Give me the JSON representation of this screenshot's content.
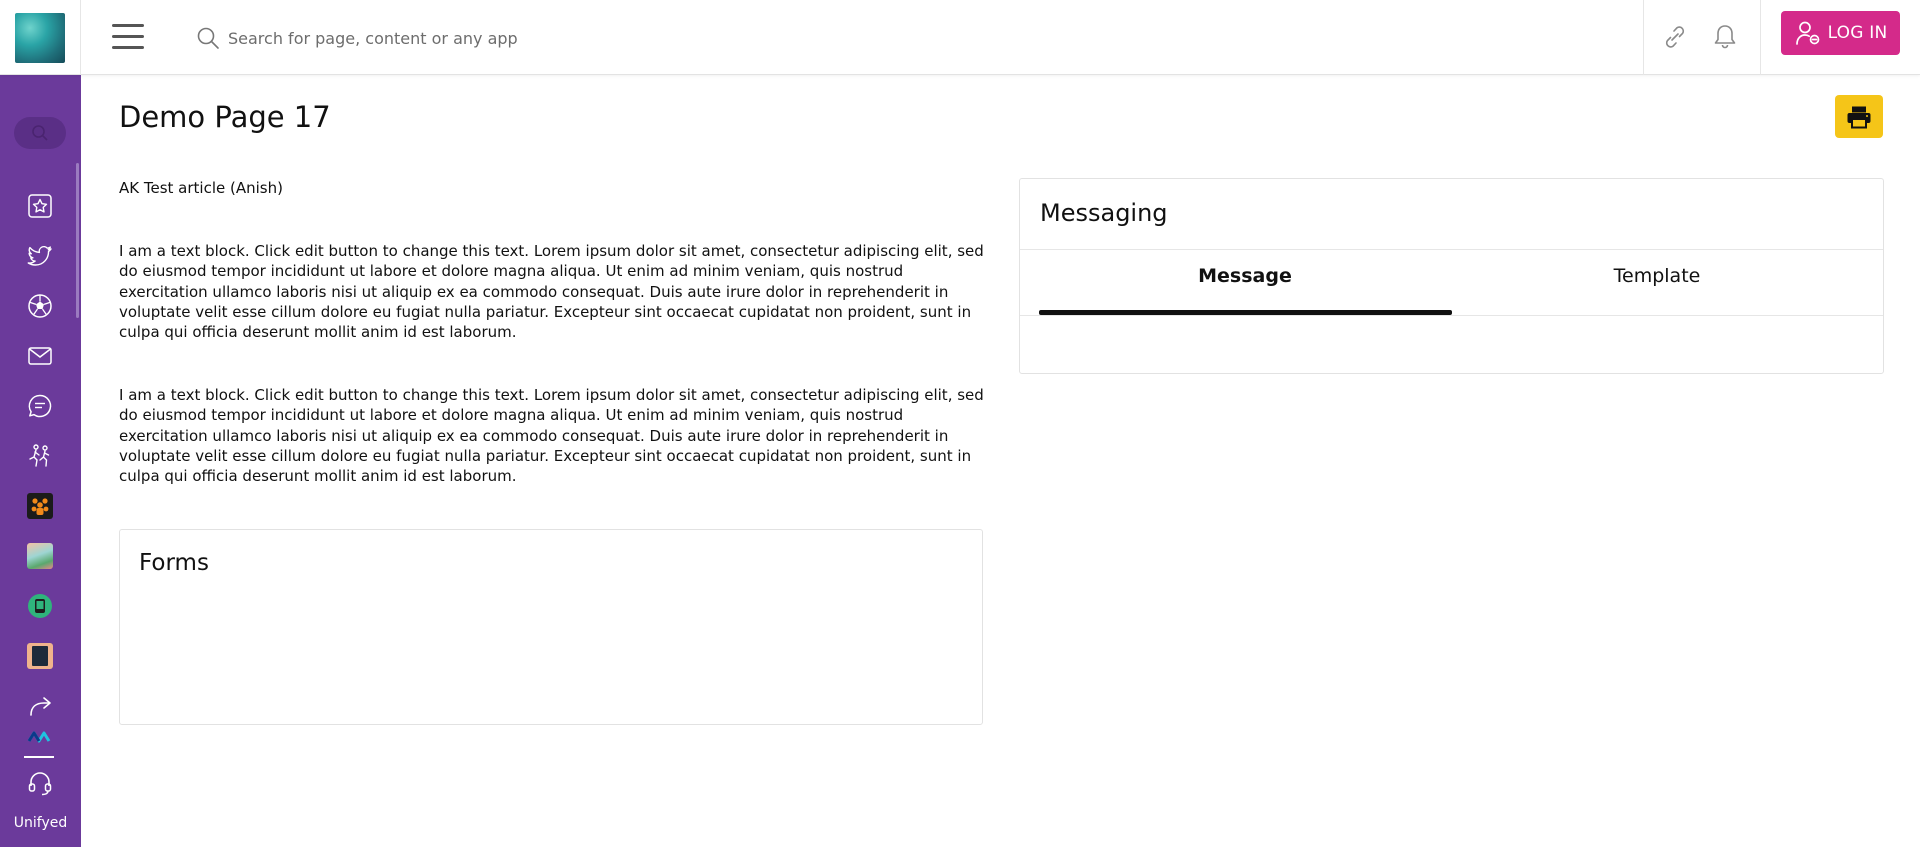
{
  "header": {
    "search_placeholder": "Search for page, content or any app",
    "login_label": "LOG IN"
  },
  "sidebar": {
    "items": [
      {
        "icon": "star-icon"
      },
      {
        "icon": "twitter-icon"
      },
      {
        "icon": "soccer-ball-icon"
      },
      {
        "icon": "mail-icon"
      },
      {
        "icon": "chat-icon"
      },
      {
        "icon": "running-people-icon"
      },
      {
        "icon": "orange-group-app-icon"
      },
      {
        "icon": "landscape-app-icon"
      },
      {
        "icon": "green-phone-app-icon"
      },
      {
        "icon": "dark-book-app-icon"
      },
      {
        "icon": "share-arrow-icon"
      },
      {
        "icon": "wave-logo-icon"
      }
    ],
    "support_icon": "headset-icon",
    "bottom_label": "Unifyed"
  },
  "page": {
    "title": "Demo Page 17",
    "article_title": "AK Test article (Anish)",
    "paragraphs": [
      "I am a text block. Click edit button to change this text. Lorem ipsum dolor sit amet, consectetur adipiscing elit, sed do eiusmod tempor incididunt ut labore et dolore magna aliqua. Ut enim ad minim veniam, quis nostrud exercitation ullamco laboris nisi ut aliquip ex ea commodo consequat. Duis aute irure dolor in reprehenderit in voluptate velit esse cillum dolore eu fugiat nulla pariatur. Excepteur sint occaecat cupidatat non proident, sunt in culpa qui officia deserunt mollit anim id est laborum.",
      "I am a text block. Click edit button to change this text. Lorem ipsum dolor sit amet, consectetur adipiscing elit, sed do eiusmod tempor incididunt ut labore et dolore magna aliqua. Ut enim ad minim veniam, quis nostrud exercitation ullamco laboris nisi ut aliquip ex ea commodo consequat. Duis aute irure dolor in reprehenderit in voluptate velit esse cillum dolore eu fugiat nulla pariatur. Excepteur sint occaecat cupidatat non proident, sunt in culpa qui officia deserunt mollit anim id est laborum."
    ],
    "forms_title": "Forms"
  },
  "messaging": {
    "title": "Messaging",
    "tabs": [
      {
        "label": "Message",
        "active": true
      },
      {
        "label": "Template",
        "active": false
      }
    ]
  },
  "colors": {
    "sidebar": "#6b3a9b",
    "login_button": "#d42a8a",
    "print_button": "#f5c518"
  }
}
